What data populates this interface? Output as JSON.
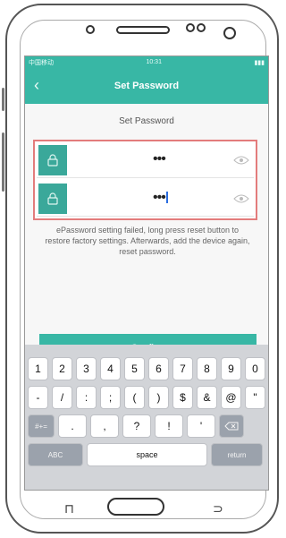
{
  "status": {
    "carrier": "中国移动",
    "time": "10:31"
  },
  "nav": {
    "title": "Set Password"
  },
  "form": {
    "section_title": "Set Password",
    "password1": "•••",
    "password2": "•••",
    "info": "ePassword setting failed, long press reset button to restore factory settings. Afterwards, add the device again, reset password.",
    "confirm_label": "Confirm"
  },
  "keyboard": {
    "row1": [
      "1",
      "2",
      "3",
      "4",
      "5",
      "6",
      "7",
      "8",
      "9",
      "0"
    ],
    "row2": [
      "-",
      "/",
      ":",
      ";",
      "(",
      ")",
      "$",
      "&",
      "@",
      "\""
    ],
    "row3": [
      "#+=",
      ".",
      ",",
      "?",
      "!",
      "'"
    ],
    "abc": "ABC",
    "space": "space",
    "return": "return"
  },
  "colors": {
    "accent": "#38b7a5",
    "error_outline": "#e37c7c"
  }
}
